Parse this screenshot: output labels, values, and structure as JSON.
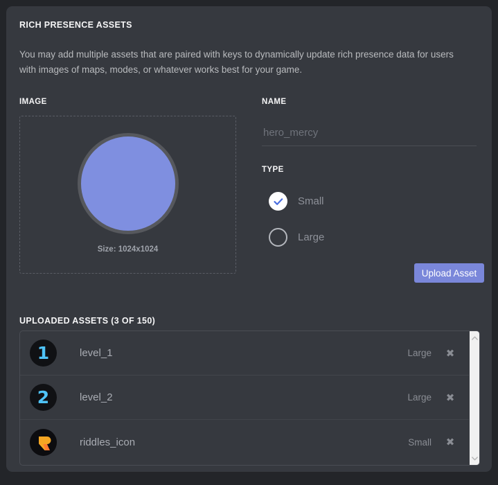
{
  "section": {
    "title": "RICH PRESENCE ASSETS",
    "description": "You may add multiple assets that are paired with keys to dynamically update rich presence data for users with images of maps, modes, or whatever works best for your game."
  },
  "image_field": {
    "label": "IMAGE",
    "size_text": "Size: 1024x1024",
    "preview_color": "#7f8fe0",
    "preview_border_color": "#56585d",
    "dropzone_border_color": "#5b5e66"
  },
  "name_field": {
    "label": "NAME",
    "value": "",
    "placeholder": "hero_mercy"
  },
  "type_field": {
    "label": "TYPE",
    "selected": "Small",
    "options": [
      {
        "label": "Small",
        "checked": true
      },
      {
        "label": "Large",
        "checked": false
      }
    ],
    "check_color": "#4a6ee0"
  },
  "upload_button": {
    "label": "Upload Asset",
    "color": "#7a87da"
  },
  "uploaded": {
    "title": "UPLOADED ASSETS (3 OF 150)",
    "count": 3,
    "max": 150,
    "columns": [
      "icon",
      "name",
      "type",
      "delete"
    ],
    "delete_glyph": "✖",
    "rows": [
      {
        "icon": "number-one-avatar",
        "avatar_text": "1",
        "avatar_color": "#4fc3f7",
        "name": "level_1",
        "type": "Large"
      },
      {
        "icon": "number-two-avatar",
        "avatar_text": "2",
        "avatar_color": "#4fc3f7",
        "name": "level_2",
        "type": "Large"
      },
      {
        "icon": "riddles-logo-avatar",
        "avatar_text": "",
        "avatar_color": "#f5a623",
        "name": "riddles_icon",
        "type": "Small"
      }
    ],
    "scrollbar": {
      "up_arrow": "chevron-up-icon",
      "down_arrow": "chevron-down-icon"
    }
  }
}
